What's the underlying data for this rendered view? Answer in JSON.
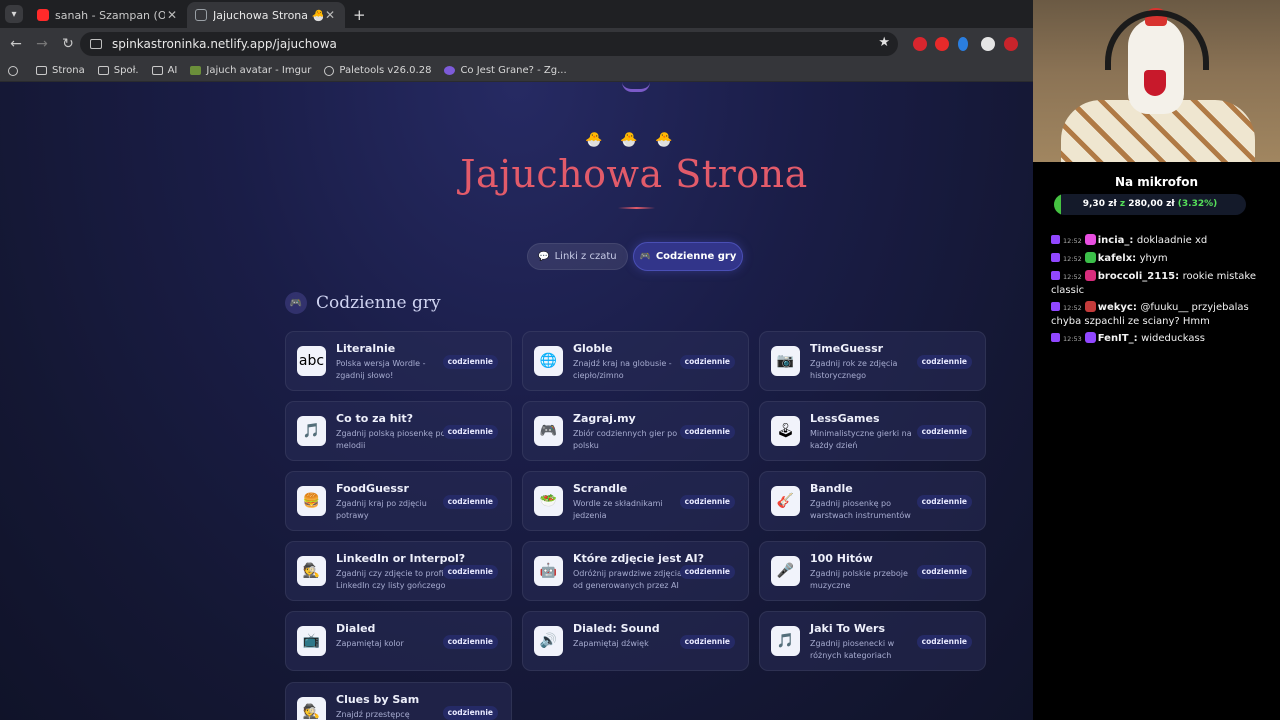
{
  "browser": {
    "tabs": [
      {
        "title": "sanah - Szampan (Official Video)",
        "favicon": "youtube-icon",
        "active": false
      },
      {
        "title": "Jajuchowa Strona 🐣",
        "favicon": "globe-icon",
        "active": true
      }
    ],
    "url": "spinkastroninka.netlify.app/jajuchowa",
    "bookmarks": [
      "Strona",
      "Społ.",
      "AI",
      "Jajuch avatar - Imgur",
      "Paletools v26.0.28",
      "Co Jest Grane? - Zg..."
    ]
  },
  "page": {
    "title": "Jajuchowa Strona",
    "chicks": [
      "🐣",
      "🐣",
      "🐣"
    ],
    "nav": {
      "links_label": "Linki z czatu",
      "games_label": "Codzienne gry"
    },
    "section_title": "Codzienne gry",
    "games": [
      {
        "name": "Literalnie",
        "desc": "Polska wersja Wordle - zgadnij słowo!",
        "badge": "codziennie",
        "icon": "abc"
      },
      {
        "name": "Globle",
        "desc": "Znajdź kraj na globusie - ciepło/zimno",
        "badge": "codziennie",
        "icon": "🌐"
      },
      {
        "name": "TimeGuessr",
        "desc": "Zgadnij rok ze zdjęcia historycznego",
        "badge": "codziennie",
        "icon": "📷"
      },
      {
        "name": "Co to za hit?",
        "desc": "Zgadnij polską piosenkę po melodii",
        "badge": "codziennie",
        "icon": "🎵"
      },
      {
        "name": "Zagraj.my",
        "desc": "Zbiór codziennych gier po polsku",
        "badge": "codziennie",
        "icon": "🎮"
      },
      {
        "name": "LessGames",
        "desc": "Minimalistyczne gierki na każdy dzień",
        "badge": "codziennie",
        "icon": "🕹"
      },
      {
        "name": "FoodGuessr",
        "desc": "Zgadnij kraj po zdjęciu potrawy",
        "badge": "codziennie",
        "icon": "🍔"
      },
      {
        "name": "Scrandle",
        "desc": "Wordle ze składnikami jedzenia",
        "badge": "codziennie",
        "icon": "🥗"
      },
      {
        "name": "Bandle",
        "desc": "Zgadnij piosenkę po warstwach instrumentów",
        "badge": "codziennie",
        "icon": "🎸"
      },
      {
        "name": "LinkedIn or Interpol?",
        "desc": "Zgadnij czy zdjęcie to profil LinkedIn czy listy gończego",
        "badge": "codziennie",
        "icon": "🕵"
      },
      {
        "name": "Które zdjęcie jest AI?",
        "desc": "Odróżnij prawdziwe zdjęcia od generowanych przez AI",
        "badge": "codziennie",
        "icon": "🤖"
      },
      {
        "name": "100 Hitów",
        "desc": "Zgadnij polskie przeboje muzyczne",
        "badge": "codziennie",
        "icon": "🎤"
      },
      {
        "name": "Dialed",
        "desc": "Zapamiętaj kolor",
        "badge": "codziennie",
        "icon": "📺"
      },
      {
        "name": "Dialed: Sound",
        "desc": "Zapamiętaj dźwięk",
        "badge": "codziennie",
        "icon": "🔊"
      },
      {
        "name": "Jaki To Wers",
        "desc": "Zgadnij piosenecki w różnych kategoriach",
        "badge": "codziennie",
        "icon": "🎵"
      },
      {
        "name": "Clues by Sam",
        "desc": "Znajdź przestępcę",
        "badge": "codziennie",
        "icon": "🕵"
      }
    ]
  },
  "stream": {
    "goal_title": "Na mikrofon",
    "goal_current": "9,30 zł",
    "goal_sep": "z",
    "goal_target": "280,00 zł",
    "goal_percent": "(3.32%)",
    "goal_fraction": 0.0332,
    "chat": [
      {
        "time": "12:52",
        "user": "incia_",
        "color": "#ffffff",
        "msg": "doklaadnie xd"
      },
      {
        "time": "12:52",
        "user": "kafelx",
        "color": "#ffffff",
        "msg": "yhym"
      },
      {
        "time": "12:52",
        "user": "broccoli_2115",
        "color": "#ffffff",
        "msg": "rookie mistake classic"
      },
      {
        "time": "12:52",
        "user": "wekyc",
        "color": "#ffffff",
        "msg": "@fuuku__ przyjebalas chyba szpachli ze sciany? Hmm"
      },
      {
        "time": "12:53",
        "user": "FenIT_",
        "color": "#ffffff",
        "msg": "wideduckass"
      }
    ]
  }
}
